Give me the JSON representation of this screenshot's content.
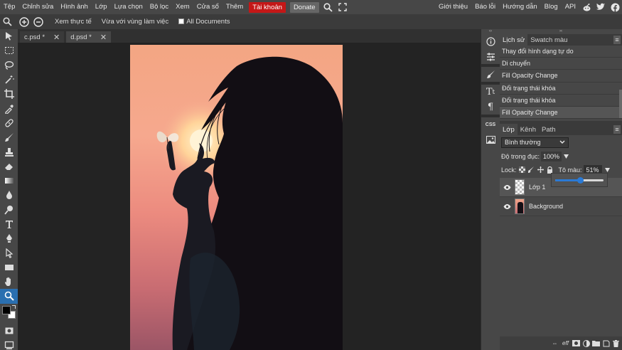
{
  "menu": {
    "items": [
      "Tệp",
      "Chỉnh sửa",
      "Hình ảnh",
      "Lớp",
      "Lựa chọn",
      "Bộ lọc",
      "Xem",
      "Cửa sổ",
      "Thêm"
    ],
    "account": "Tài khoản",
    "donate": "Donate",
    "right_links": [
      "Giới thiệu",
      "Báo lỗi",
      "Hướng dẫn",
      "Blog",
      "API"
    ],
    "colors": {
      "account_bg": "#c41717"
    }
  },
  "options": {
    "zoom_buttons": [
      "zoom-in",
      "zoom-out"
    ],
    "actual_pixels": "Xem thực tế",
    "fit_area": "Vừa với vùng làm việc",
    "all_documents": "All Documents",
    "all_documents_checked": false
  },
  "tabs": [
    {
      "label": "c.psd *",
      "active": false
    },
    {
      "label": "d.psd *",
      "active": true
    }
  ],
  "tools": [
    "move",
    "marquee",
    "lasso",
    "magic-wand",
    "crop",
    "eyedropper",
    "healing",
    "brush",
    "stamp",
    "eraser",
    "gradient",
    "blur",
    "dodge",
    "type",
    "pen",
    "path-select",
    "rectangle",
    "hand",
    "zoom"
  ],
  "active_tool": "zoom",
  "colors": {
    "foreground": "#000000",
    "background": "#ffffff",
    "selection": "#2a6fb0"
  },
  "history": {
    "tabs": [
      "Lịch sử",
      "Swatch màu"
    ],
    "entries": [
      "Thay đổi hình dạng tự do",
      "Di chuyển",
      "Fill Opacity Change",
      "Đổi trạng thái khóa",
      "Đổi trạng thái khóa",
      "Fill Opacity Change"
    ]
  },
  "layers": {
    "tabs": [
      "Lớp",
      "Kênh",
      "Path"
    ],
    "blend_mode": "Bình thường",
    "opacity_label": "Độ trong đục:",
    "opacity_value": "100%",
    "lock_label": "Lock:",
    "fill_label": "Tô màu:",
    "fill_value": "51%",
    "fill_slider_fraction": 0.51,
    "items": [
      {
        "name": "Lớp 1",
        "selected": true
      },
      {
        "name": "Background",
        "selected": false
      }
    ]
  },
  "minipanel": {
    "css_label": "CSS"
  },
  "footer": {
    "eff_label": "eff"
  }
}
